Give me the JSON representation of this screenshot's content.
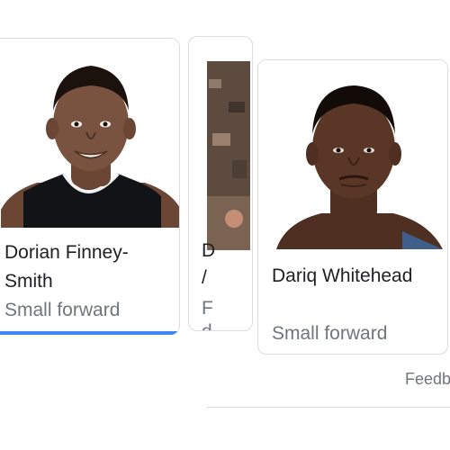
{
  "cards": [
    {
      "name": "Dorian Finney-\nSmith",
      "role": "Small forward"
    },
    {
      "name_fragment_top": "D",
      "name_fragment_bottom": "/",
      "role_fragment_top": "F",
      "role_fragment_bottom": "d"
    },
    {
      "name": "Dariq Whitehead",
      "role": "Small forward"
    }
  ],
  "footer": {
    "feedback": "Feedb"
  },
  "colors": {
    "accent": "#4285f4",
    "border": "#dadce0",
    "secondary_text": "#70757a"
  }
}
